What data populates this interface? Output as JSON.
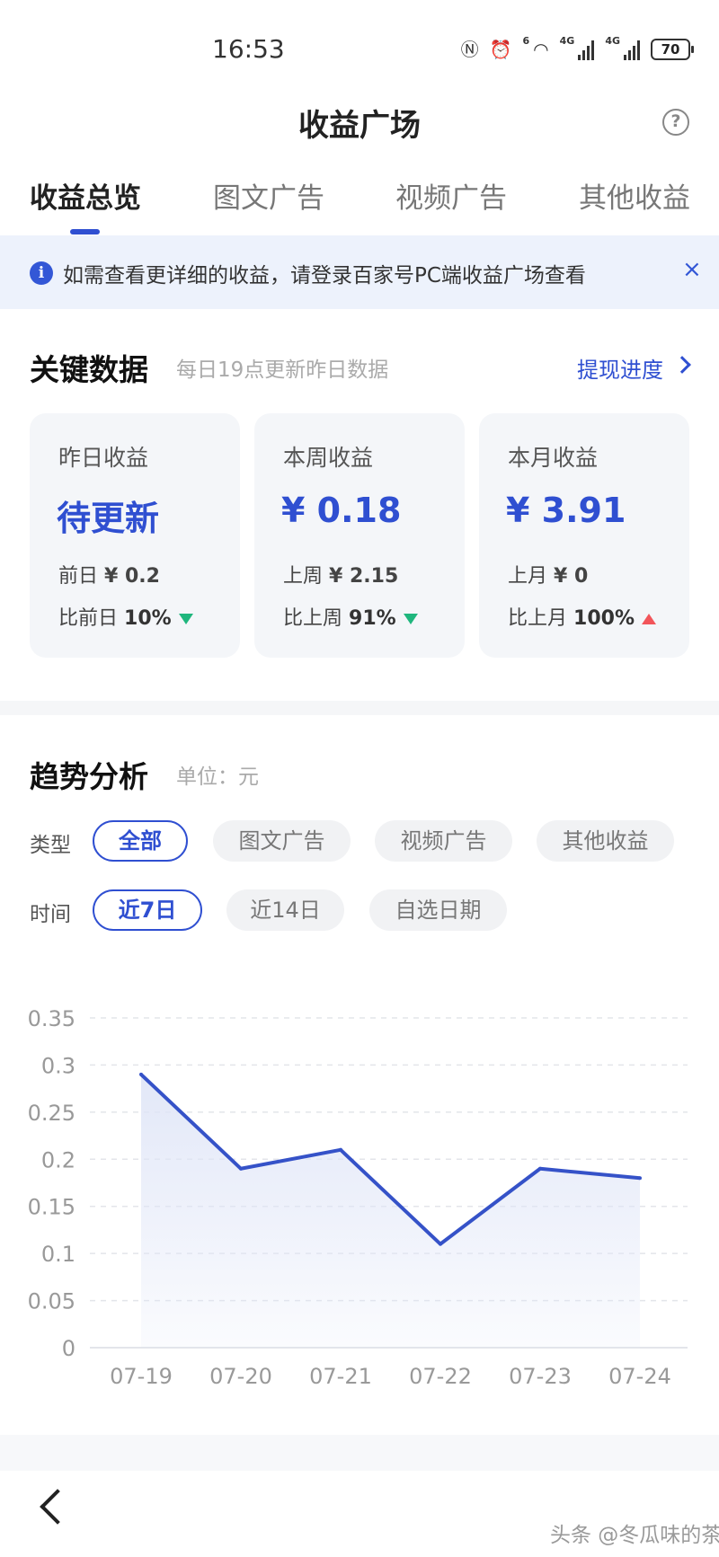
{
  "status_bar": {
    "time": "16:53",
    "icons": [
      "nfc-icon",
      "alarm-icon",
      "wifi-icon",
      "signal-4g-icon",
      "signal-4g-icon"
    ],
    "wifi_tag": "6",
    "signal_tag": "4G",
    "battery": "70"
  },
  "header": {
    "title": "收益广场",
    "help_icon": "question-circle-icon"
  },
  "tabs": [
    {
      "label": "收益总览",
      "active": true
    },
    {
      "label": "图文广告",
      "active": false
    },
    {
      "label": "视频广告",
      "active": false
    },
    {
      "label": "其他收益",
      "active": false
    }
  ],
  "notice": {
    "icon": "info-icon",
    "text": "如需查看更详细的收益，请登录百家号PC端收益广场查看",
    "close": "×"
  },
  "key_data": {
    "title": "关键数据",
    "subtitle": "每日19点更新昨日数据",
    "link": "提现进度",
    "cards": [
      {
        "label": "昨日收益",
        "value": "待更新",
        "prev_label": "前日",
        "prev_value": "¥ 0.2",
        "cmp_label": "比前日",
        "cmp_value": "10%",
        "trend": "down"
      },
      {
        "label": "本周收益",
        "value": "¥ 0.18",
        "prev_label": "上周",
        "prev_value": "¥ 2.15",
        "cmp_label": "比上周",
        "cmp_value": "91%",
        "trend": "down"
      },
      {
        "label": "本月收益",
        "value": "¥ 3.91",
        "prev_label": "上月",
        "prev_value": "¥ 0",
        "cmp_label": "比上月",
        "cmp_value": "100%",
        "trend": "up"
      }
    ]
  },
  "trend": {
    "title": "趋势分析",
    "unit": "单位：元",
    "type_label": "类型",
    "type_options": [
      {
        "label": "全部",
        "active": true
      },
      {
        "label": "图文广告",
        "active": false
      },
      {
        "label": "视频广告",
        "active": false
      },
      {
        "label": "其他收益",
        "active": false
      }
    ],
    "time_label": "时间",
    "time_options": [
      {
        "label": "近7日",
        "active": true
      },
      {
        "label": "近14日",
        "active": false
      },
      {
        "label": "自选日期",
        "active": false
      }
    ]
  },
  "chart_data": {
    "type": "area",
    "categories": [
      "07-19",
      "07-20",
      "07-21",
      "07-22",
      "07-23",
      "07-24"
    ],
    "series": [
      {
        "values": [
          0.29,
          0.19,
          0.21,
          0.11,
          0.19,
          0.18
        ]
      }
    ],
    "y_ticks": [
      "0",
      "0.05",
      "0.1",
      "0.15",
      "0.2",
      "0.25",
      "0.3",
      "0.35"
    ],
    "ylim": [
      0,
      0.35
    ],
    "grid": true,
    "line_color": "#3552c8",
    "fill_color": "#dfe5f7"
  },
  "footer": {
    "back_icon": "back-chevron-icon",
    "watermark": "头条 @冬瓜味的茶"
  },
  "colors": {
    "accent": "#2f4fd1",
    "down": "#1fb67d",
    "up": "#f2555a"
  }
}
